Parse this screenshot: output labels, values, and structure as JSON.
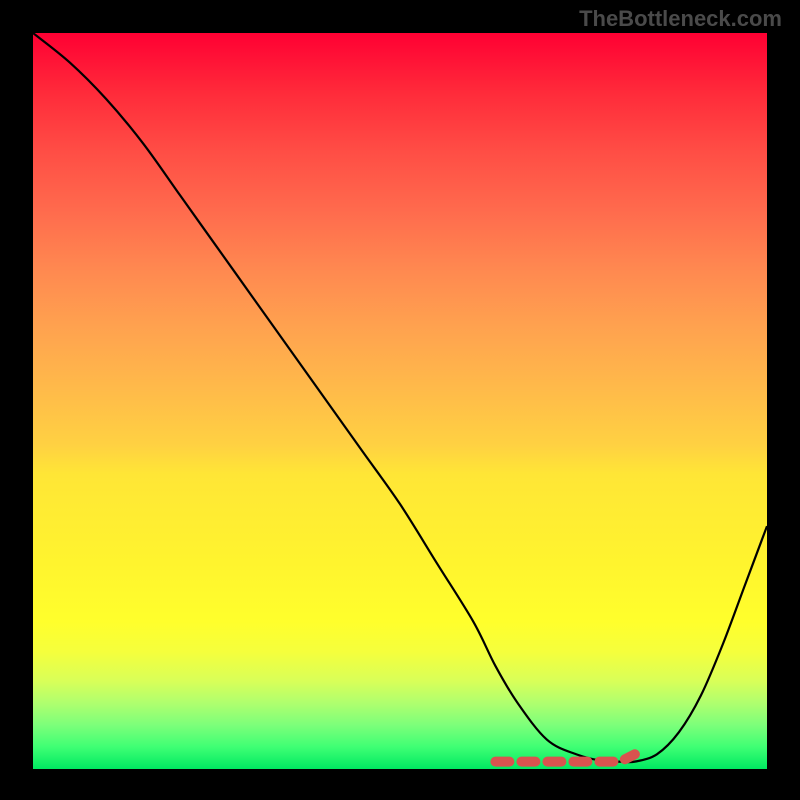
{
  "watermark": "TheBottleneck.com",
  "chart_data": {
    "type": "line",
    "title": "",
    "xlabel": "",
    "ylabel": "",
    "xlim": [
      0,
      100
    ],
    "ylim": [
      0,
      100
    ],
    "series": [
      {
        "name": "bottleneck-curve",
        "x": [
          0,
          5,
          10,
          15,
          20,
          25,
          30,
          35,
          40,
          45,
          50,
          55,
          60,
          63,
          66,
          70,
          74,
          78,
          80,
          82,
          85,
          88,
          91,
          94,
          97,
          100
        ],
        "values": [
          100,
          96,
          91,
          85,
          78,
          71,
          64,
          57,
          50,
          43,
          36,
          28,
          20,
          14,
          9,
          4,
          2,
          1,
          1,
          1,
          2,
          5,
          10,
          17,
          25,
          33
        ]
      },
      {
        "name": "optimal-range-marker",
        "x": [
          63,
          66,
          70,
          74,
          78,
          80,
          82
        ],
        "values": [
          1,
          1,
          1,
          1,
          1,
          1,
          2
        ]
      }
    ],
    "colors": {
      "curve": "#000000",
      "marker": "#d9534f"
    }
  }
}
